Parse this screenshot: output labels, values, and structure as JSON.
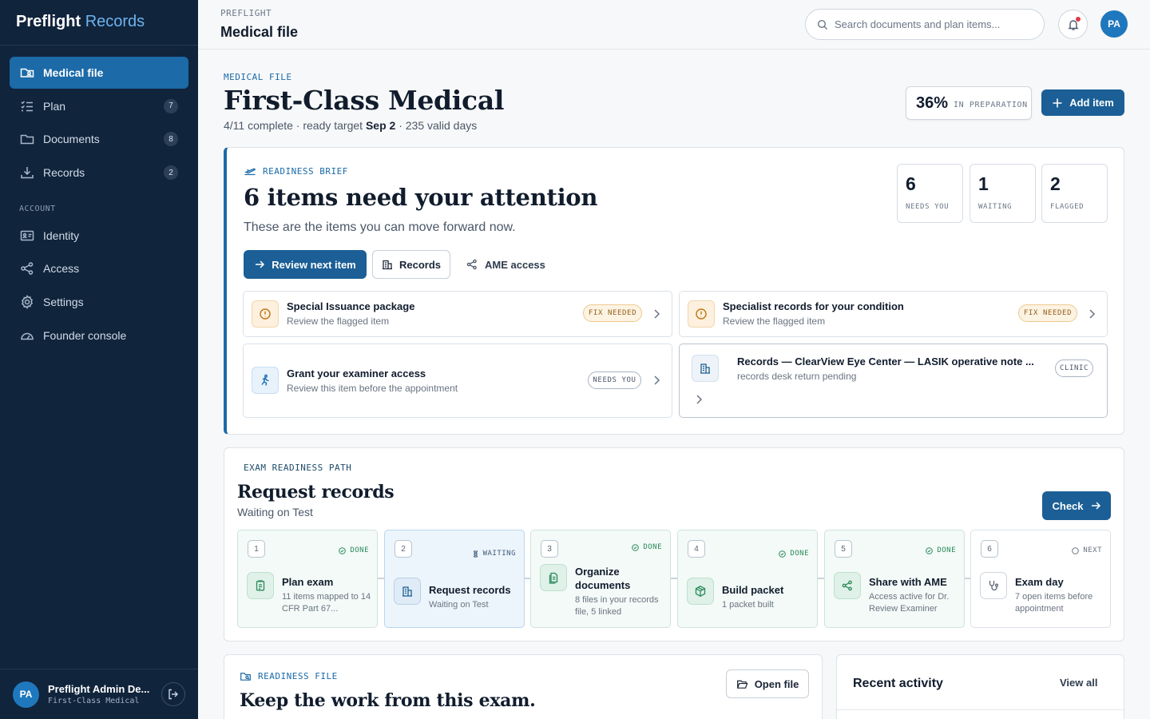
{
  "brand": {
    "name": "Preflight",
    "accent": "Records"
  },
  "sidebar": {
    "items": [
      {
        "label": "Medical file",
        "badge": "",
        "icon": "folder-user-icon",
        "active": true
      },
      {
        "label": "Plan",
        "badge": "7",
        "icon": "checklist-icon"
      },
      {
        "label": "Documents",
        "badge": "8",
        "icon": "folder-icon"
      },
      {
        "label": "Records",
        "badge": "2",
        "icon": "download-icon"
      }
    ],
    "section_label": "ACCOUNT",
    "account_items": [
      {
        "label": "Identity",
        "icon": "id-card-icon"
      },
      {
        "label": "Access",
        "icon": "share-icon"
      },
      {
        "label": "Settings",
        "icon": "gear-icon"
      },
      {
        "label": "Founder console",
        "icon": "gauge-icon"
      }
    ],
    "user": {
      "initials": "PA",
      "name": "Preflight Admin De...",
      "sub": "First-Class Medical"
    }
  },
  "topbar": {
    "crumb": "PREFLIGHT",
    "title": "Medical file",
    "search_placeholder": "Search documents and plan items...",
    "avatar": "PA"
  },
  "page": {
    "eyebrow": "MEDICAL FILE",
    "title": "First-Class Medical",
    "meta_prefix": "4/11 complete · ready target ",
    "meta_date": "Sep 2",
    "meta_suffix": " · 235 valid days",
    "progress_pct": "36%",
    "progress_label": "IN PREPARATION",
    "progress_value": 0.36,
    "add_label": "Add item"
  },
  "brief": {
    "eyebrow": "READINESS BRIEF",
    "title": "6 items need your attention",
    "subtitle": "These are the items you can move forward now.",
    "stats": [
      {
        "num": "6",
        "label": "NEEDS YOU"
      },
      {
        "num": "1",
        "label": "WAITING"
      },
      {
        "num": "2",
        "label": "FLAGGED"
      }
    ],
    "review_label": "Review next item",
    "records_label": "Records",
    "ame_label": "AME access",
    "tasks": [
      {
        "title": "Special Issuance package",
        "sub": "Review the flagged item",
        "pill": "FIX NEEDED"
      },
      {
        "title": "Specialist records for your condition",
        "sub": "Review the flagged item",
        "pill": "FIX NEEDED"
      },
      {
        "title": "Grant your examiner access",
        "sub": "Review this item before the appointment",
        "pill": "NEEDS YOU"
      },
      {
        "title": "Records — ClearView Eye Center — LASIK operative note ...",
        "sub": "records desk return pending",
        "pill": "CLINIC"
      }
    ]
  },
  "path": {
    "eyebrow": "EXAM READINESS PATH",
    "title": "Request records",
    "subtitle": "Waiting on Test",
    "check_label": "Check",
    "steps": [
      {
        "n": "1",
        "status": "DONE",
        "title": "Plan exam",
        "desc": "11 items mapped to 14 CFR Part 67..."
      },
      {
        "n": "2",
        "status": "WAITING",
        "title": "Request records",
        "desc": "Waiting on Test"
      },
      {
        "n": "3",
        "status": "DONE",
        "title": "Organize documents",
        "desc": "8 files in your records file, 5 linked"
      },
      {
        "n": "4",
        "status": "DONE",
        "title": "Build packet",
        "desc": "1 packet built"
      },
      {
        "n": "5",
        "status": "DONE",
        "title": "Share with AME",
        "desc": "Access active for Dr. Review Examiner"
      },
      {
        "n": "6",
        "status": "NEXT",
        "title": "Exam day",
        "desc": "7 open items before appointment"
      }
    ]
  },
  "readiness_file": {
    "eyebrow": "READINESS FILE",
    "title": "Keep the work from this exam.",
    "open_label": "Open file"
  },
  "activity": {
    "title": "Recent activity",
    "view_all": "View all"
  },
  "colors": {
    "sidebar": "#10243c",
    "accent": "#1c6aa8",
    "primary_button": "#1b5f96",
    "done": "#2a8a5b",
    "warn": "#c07612"
  }
}
